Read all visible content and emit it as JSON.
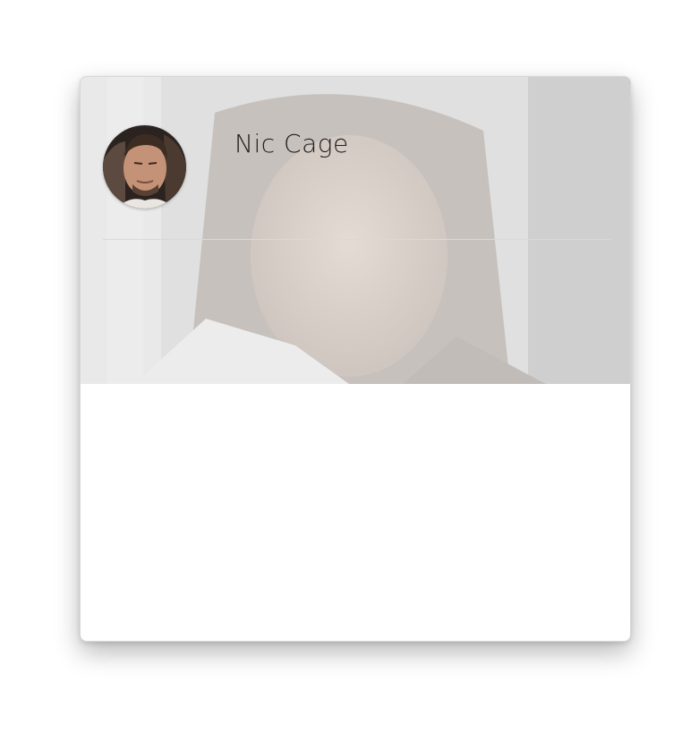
{
  "profile": {
    "name": "Nic Cage",
    "avatar_icon": "profile-photo-avatar",
    "cover_icon": "cover-photo-background"
  },
  "colors": {
    "header_bg": "#e6e6e6",
    "text": "#1f1f1f",
    "divider": "#d9d9d9",
    "card_bg": "#ffffff"
  }
}
